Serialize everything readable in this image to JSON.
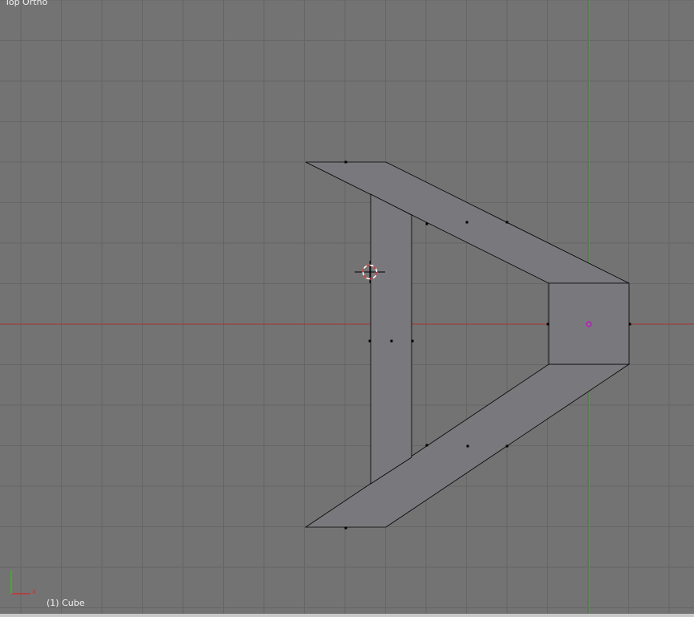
{
  "viewport": {
    "view_label": "Top Ortho",
    "object_label": "(1) Cube",
    "axis_x_label": "x"
  },
  "colors": {
    "background": "#737373",
    "grid": "#666666",
    "x_axis": "#a33636",
    "y_axis": "#4a9e3c",
    "face_fill": "#79787d",
    "edge": "#000000",
    "vertex": "#000000",
    "origin": "#d000d0",
    "cursor_red": "#d03030",
    "cursor_white": "#ffffff"
  },
  "icons": [
    "3d-cursor-icon",
    "object-origin-icon",
    "axis-gizmo-icon"
  ]
}
